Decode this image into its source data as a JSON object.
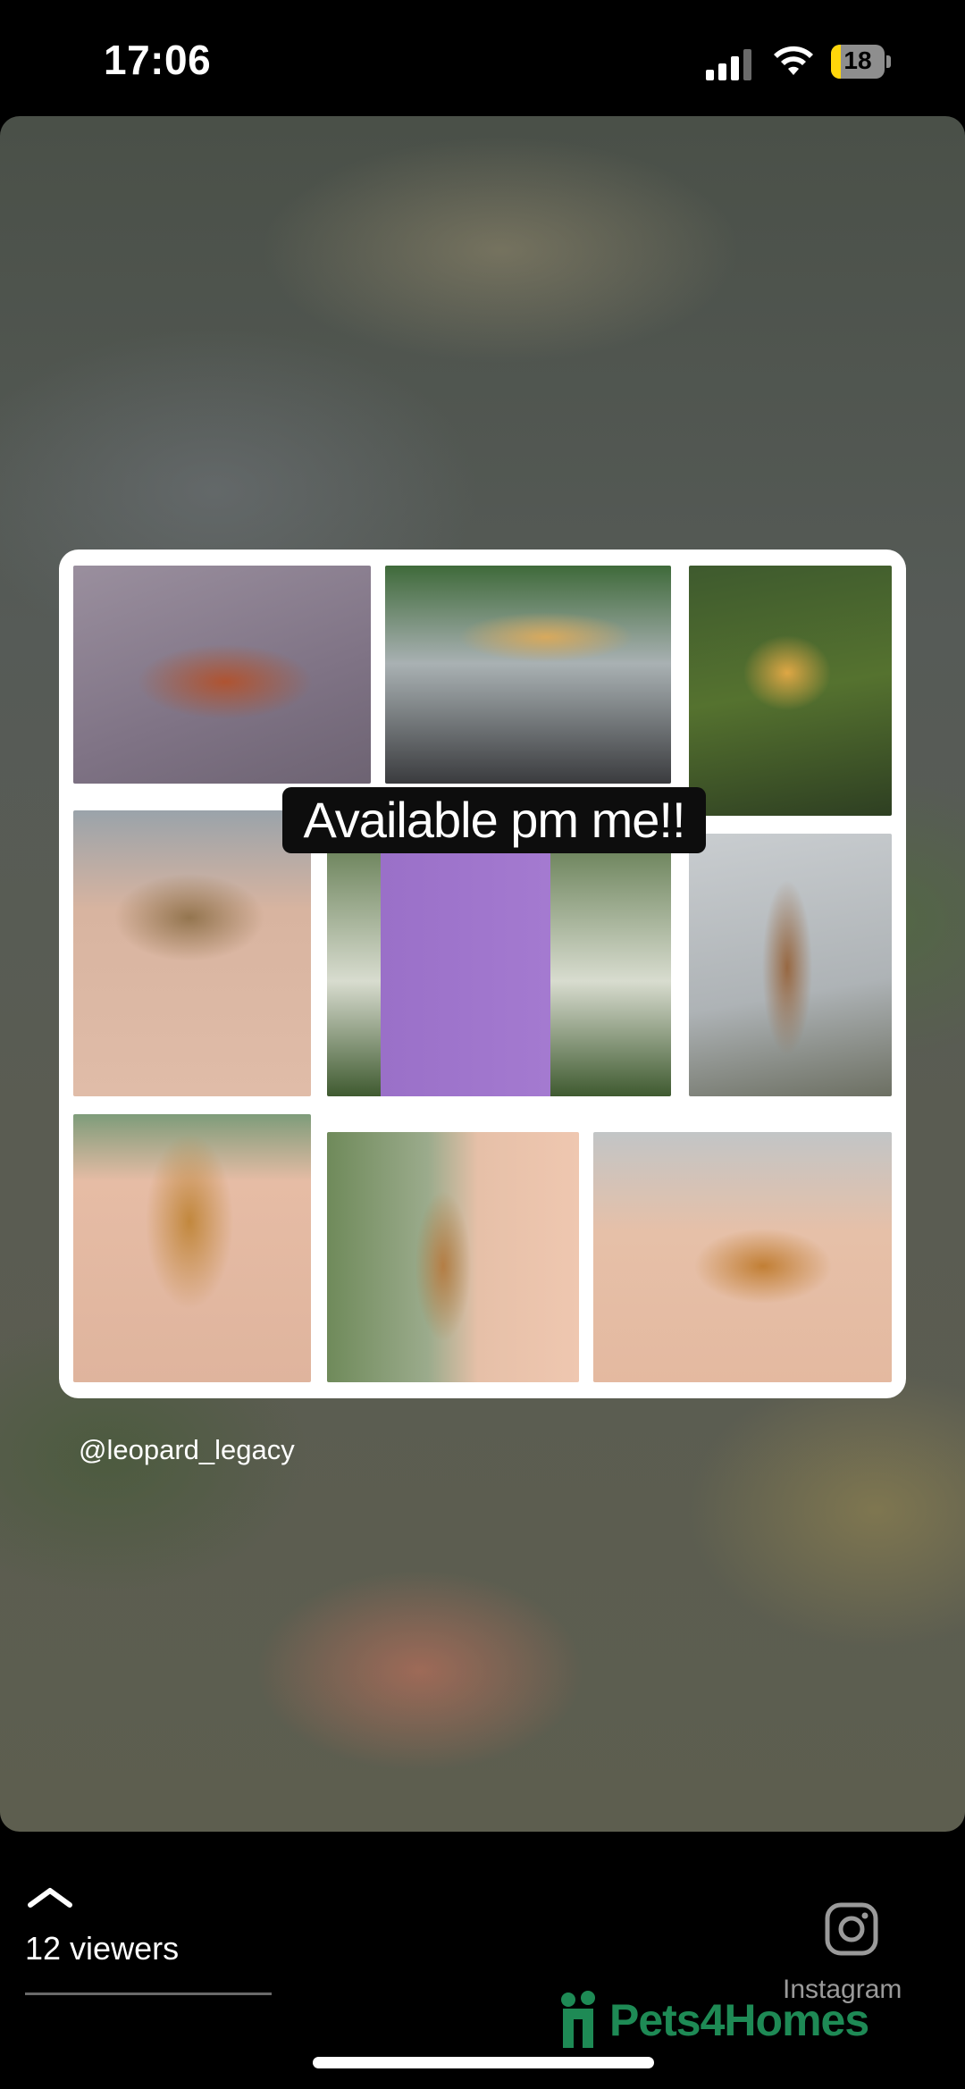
{
  "status_bar": {
    "time": "17:06",
    "battery_level": "18"
  },
  "story": {
    "caption": "Available pm me!!",
    "handle": "@leopard_legacy"
  },
  "footer": {
    "viewers_label": "12 viewers",
    "source_label": "Instagram",
    "watermark": "Pets4Homes"
  },
  "icons": [
    "signal-icon",
    "wifi-icon",
    "battery-icon",
    "chevron-up-icon",
    "instagram-icon",
    "pets4homes-logo-icon"
  ],
  "colors": {
    "accent_battery": "#ffd60a",
    "watermark_green": "#1e8a55"
  }
}
